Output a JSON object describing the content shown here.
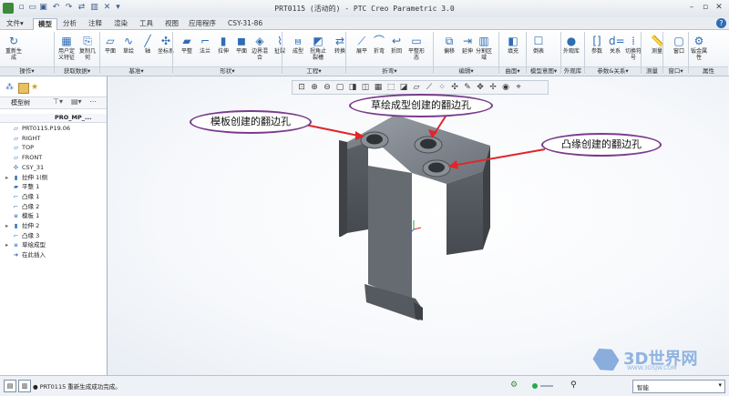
{
  "window": {
    "title": "PRT0115 (活动的) - PTC Creo Parametric 3.0"
  },
  "tabs": [
    {
      "label": "文件▾"
    },
    {
      "label": "模型"
    },
    {
      "label": "分析"
    },
    {
      "label": "注释"
    },
    {
      "label": "渲染"
    },
    {
      "label": "工具"
    },
    {
      "label": "视图"
    },
    {
      "label": "应用程序"
    },
    {
      "label": "CSY-31-86"
    }
  ],
  "ribbon": {
    "buttons": [
      {
        "label": "重新生成",
        "icon": "regenerate-icon",
        "glyph": "↻"
      },
      {
        "label": "用户定义特征",
        "icon": "udf-icon",
        "glyph": "▦"
      },
      {
        "label": "复制几何",
        "icon": "copy-geom-icon",
        "glyph": "⎘"
      },
      {
        "label": "平面",
        "icon": "plane-icon",
        "glyph": "▱"
      },
      {
        "label": "草绘",
        "icon": "sketch-icon",
        "glyph": "∿"
      },
      {
        "label": "轴",
        "icon": "axis-icon",
        "glyph": "╱"
      },
      {
        "label": "坐标系",
        "icon": "csys-icon",
        "glyph": "✣"
      },
      {
        "label": "平整",
        "icon": "flat-icon",
        "glyph": "▰"
      },
      {
        "label": "法兰",
        "icon": "flange-icon",
        "glyph": "⌐"
      },
      {
        "label": "拉伸",
        "icon": "extrude-icon",
        "glyph": "▮"
      },
      {
        "label": "平面",
        "icon": "planar-icon",
        "glyph": "◼"
      },
      {
        "label": "边界混合",
        "icon": "boundary-icon",
        "glyph": "◈"
      },
      {
        "label": "扯裂",
        "icon": "rip-icon",
        "glyph": "⌇"
      },
      {
        "label": "成型",
        "icon": "form-icon",
        "glyph": "⩏"
      },
      {
        "label": "拐角止裂槽",
        "icon": "corner-relief-icon",
        "glyph": "◩"
      },
      {
        "label": "转换",
        "icon": "convert-icon",
        "glyph": "⇄"
      },
      {
        "label": "展平",
        "icon": "unbend-icon",
        "glyph": "⟋"
      },
      {
        "label": "折弯",
        "icon": "bend-icon",
        "glyph": "⌒"
      },
      {
        "label": "折回",
        "icon": "bendback-icon",
        "glyph": "↩"
      },
      {
        "label": "平整形态",
        "icon": "flat-pattern-icon",
        "glyph": "▭"
      },
      {
        "label": "偏移",
        "icon": "offset-icon",
        "glyph": "⧉"
      },
      {
        "label": "延伸",
        "icon": "extend-icon",
        "glyph": "⇥"
      },
      {
        "label": "分割区域",
        "icon": "split-icon",
        "glyph": "▥"
      },
      {
        "label": "填充",
        "icon": "fill-icon",
        "glyph": "◧"
      },
      {
        "label": "倒表",
        "icon": "table-icon",
        "glyph": "☐"
      },
      {
        "label": "外观库",
        "icon": "appearance-icon",
        "glyph": "●"
      },
      {
        "label": "参数",
        "icon": "param-icon",
        "glyph": "[]"
      },
      {
        "label": "关系",
        "icon": "relations-icon",
        "glyph": "d="
      },
      {
        "label": "切换符号",
        "icon": "switch-sym-icon",
        "glyph": "⁞"
      },
      {
        "label": "测量",
        "icon": "measure-icon",
        "glyph": "📏"
      },
      {
        "label": "窗口",
        "icon": "window-icon",
        "glyph": "▢"
      },
      {
        "label": "钣金属性",
        "icon": "sm-props-icon",
        "glyph": "⚙"
      }
    ],
    "groups": [
      {
        "label": "操作▾"
      },
      {
        "label": "获取数据▾"
      },
      {
        "label": "基准▾"
      },
      {
        "label": "形状▾"
      },
      {
        "label": "工程▾"
      },
      {
        "label": "折弯▾"
      },
      {
        "label": "编辑▾"
      },
      {
        "label": "曲面▾"
      },
      {
        "label": "模型意图▾"
      },
      {
        "label": "外观库"
      },
      {
        "label": "参数&关系▾"
      },
      {
        "label": "测量"
      },
      {
        "label": "窗口▾"
      },
      {
        "label": "属性"
      }
    ]
  },
  "sidebar": {
    "header": "模型树",
    "column_header": "PRO_MP_...",
    "items": [
      {
        "label": "PRT0115.P19.06",
        "glyph": "▱",
        "expand": ""
      },
      {
        "label": "RIGHT",
        "glyph": "▱",
        "expand": ""
      },
      {
        "label": "TOP",
        "glyph": "▱",
        "expand": ""
      },
      {
        "label": "FRONT",
        "glyph": "▱",
        "expand": ""
      },
      {
        "label": "CSY_31",
        "glyph": "✣",
        "expand": ""
      },
      {
        "label": "拉伸 1(侧",
        "glyph": "▮",
        "expand": "▸"
      },
      {
        "label": "平整 1",
        "glyph": "▰",
        "expand": ""
      },
      {
        "label": "凸缘 1",
        "glyph": "⌐",
        "expand": ""
      },
      {
        "label": "凸缘 2",
        "glyph": "⌐",
        "expand": ""
      },
      {
        "label": "模板 1",
        "glyph": "⩏",
        "expand": ""
      },
      {
        "label": "拉伸 2",
        "glyph": "▮",
        "expand": "▸"
      },
      {
        "label": "凸缘 3",
        "glyph": "⌐",
        "expand": ""
      },
      {
        "label": "草绘成型",
        "glyph": "⩏",
        "expand": "▸"
      },
      {
        "label": "在此插入",
        "glyph": "➜",
        "expand": ""
      }
    ]
  },
  "annotations": {
    "template": "模板创建的翻边孔",
    "sketch": "草绘成型创建的翻边孔",
    "flange": "凸缘创建的翻边孔"
  },
  "statusbar": {
    "message": "● PRT0115 重新生成成功完成。",
    "filter": "智能"
  },
  "watermark": {
    "brand": "3D世界网",
    "url": "WWW.3DSJW.COM"
  },
  "colors": {
    "accent": "#2f6db5",
    "callout_border": "#7a3b8c",
    "arrow": "#e0262b",
    "part": "#6f7379"
  }
}
